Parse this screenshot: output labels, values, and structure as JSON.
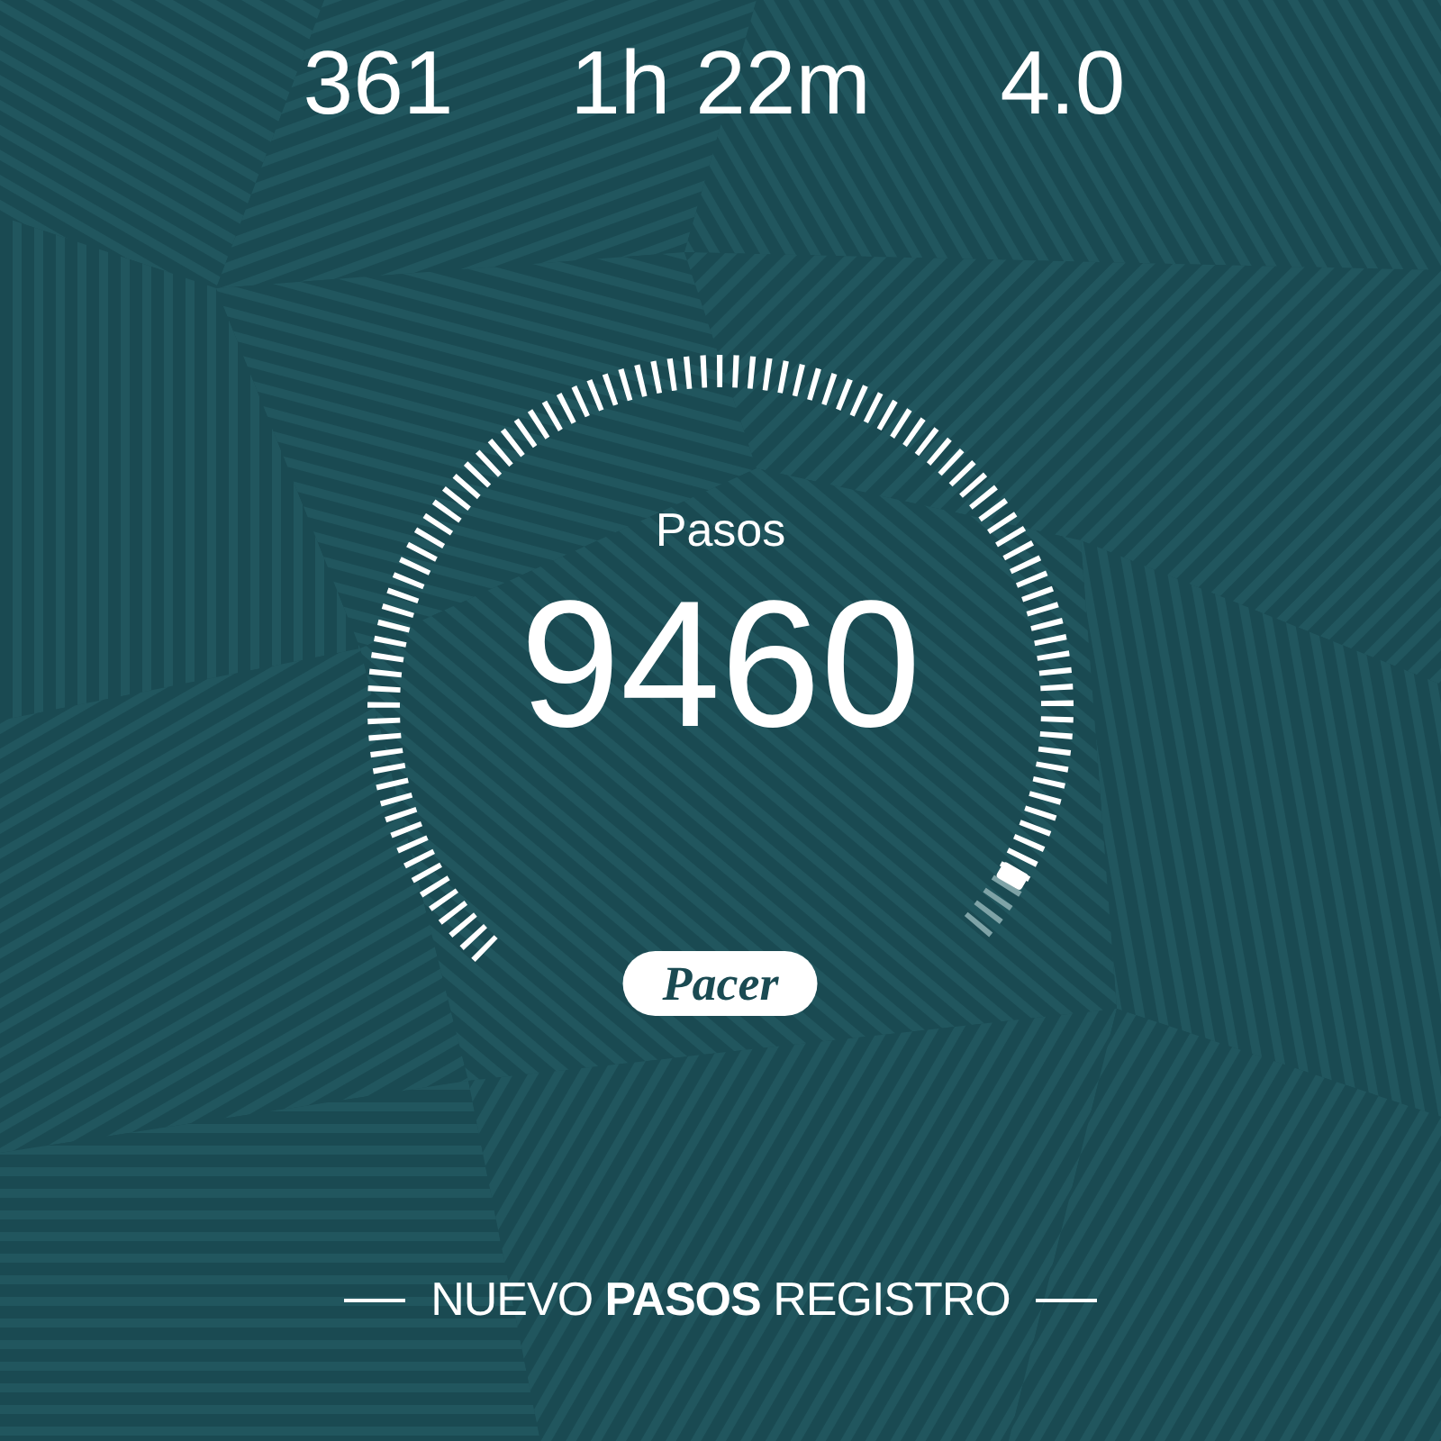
{
  "stats": [
    {
      "value": "361"
    },
    {
      "value": "1h 22m"
    },
    {
      "value": "4.0"
    }
  ],
  "gauge": {
    "label": "Pasos",
    "value": "9460",
    "level": 0.955
  },
  "logo": {
    "text": "Pacer"
  },
  "footer": {
    "text": "NUEVO **PASOS** REGISTRO"
  }
}
